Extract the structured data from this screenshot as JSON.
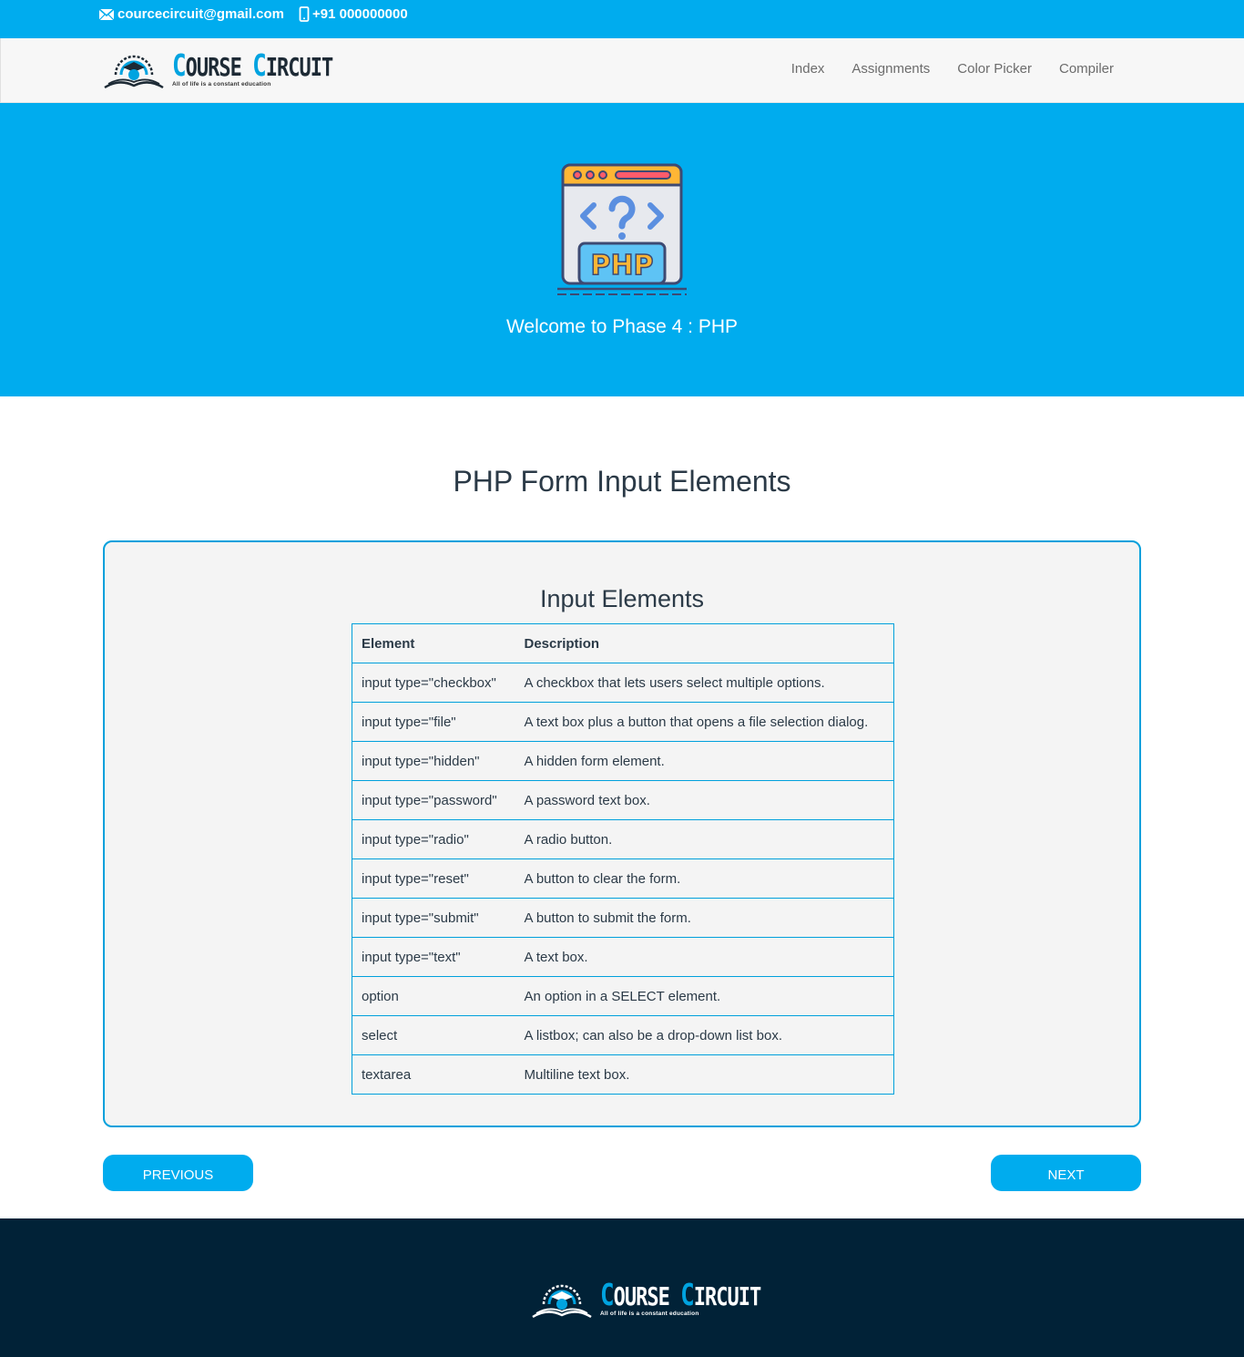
{
  "topbar": {
    "email": "courcecircuit@gmail.com",
    "phone": "+91 000000000"
  },
  "brand": {
    "name_c1": "C",
    "name_rest1": "OURSE ",
    "name_c2": "C",
    "name_rest2": "IRCUIT",
    "tagline": "All of life is a constant education"
  },
  "nav": {
    "items": [
      "Index",
      "Assignments",
      "Color Picker",
      "Compiler"
    ]
  },
  "hero": {
    "icon_label": "PHP",
    "title": "Welcome to Phase 4 : PHP"
  },
  "main": {
    "title": "PHP Form Input Elements",
    "card_title": "Input Elements",
    "table": {
      "headers": [
        "Element",
        "Description"
      ],
      "rows": [
        [
          "input type=\"checkbox\"",
          "A checkbox that lets users select multiple options."
        ],
        [
          "input type=\"file\"",
          "A text box plus a button that opens a file selection dialog."
        ],
        [
          "input type=\"hidden\"",
          "A hidden form element."
        ],
        [
          "input type=\"password\"",
          "A password text box."
        ],
        [
          "input type=\"radio\"",
          "A radio button."
        ],
        [
          "input type=\"reset\"",
          "A button to clear the form."
        ],
        [
          "input type=\"submit\"",
          "A button to submit the form."
        ],
        [
          "input type=\"text\"",
          "A text box."
        ],
        [
          "option",
          "An option in a SELECT element."
        ],
        [
          "select",
          "A listbox; can also be a drop-down list box."
        ],
        [
          "textarea",
          "Multiline text box."
        ]
      ]
    }
  },
  "buttons": {
    "previous": "PREVIOUS",
    "next": "NEXT"
  },
  "colors": {
    "accent": "#00acee",
    "footer_bg": "#012237",
    "text": "#2b3a47"
  },
  "icons": [
    "mail-icon",
    "phone-icon",
    "brand-logo-icon",
    "php-code-icon"
  ]
}
